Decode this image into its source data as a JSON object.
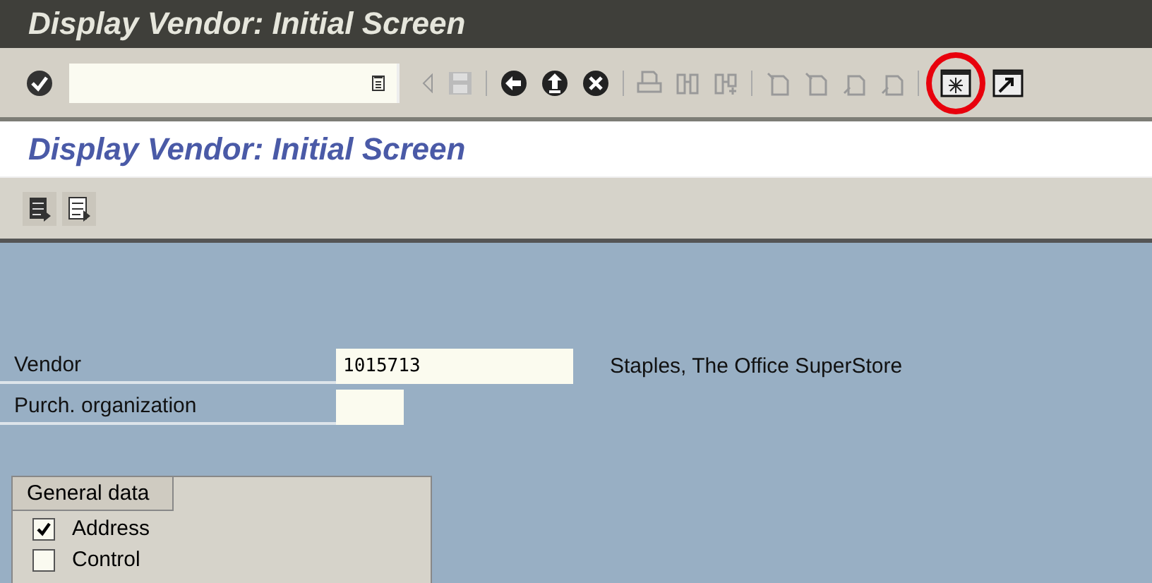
{
  "window": {
    "title": "Display Vendor:  Initial Screen"
  },
  "screen_title": "Display Vendor:  Initial Screen",
  "fields": [
    {
      "label": "Vendor",
      "value": "1015713",
      "description": "Staples, The Office SuperStore"
    },
    {
      "label": "Purch. organization"
    }
  ],
  "group": {
    "title": "General data",
    "options": [
      {
        "label": "Address",
        "checked": true
      },
      {
        "label": "Control",
        "checked": false
      }
    ]
  }
}
